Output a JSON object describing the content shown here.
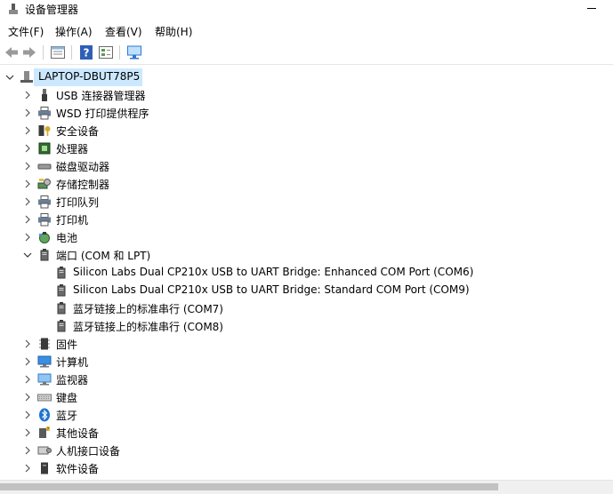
{
  "window": {
    "title": "设备管理器"
  },
  "menu": [
    "文件(F)",
    "操作(A)",
    "查看(V)",
    "帮助(H)"
  ],
  "toolbar": {
    "icons": [
      "back-arrow-icon",
      "forward-arrow-icon",
      "properties-icon",
      "help-icon",
      "show-hidden-icon",
      "monitor-scan-icon"
    ]
  },
  "tree": {
    "root": "LAPTOP-DBUT78P5",
    "categories": [
      {
        "label": "USB 连接器管理器",
        "icon": "usb-icon",
        "expanded": false
      },
      {
        "label": "WSD 打印提供程序",
        "icon": "printer-icon",
        "expanded": false
      },
      {
        "label": "安全设备",
        "icon": "security-key-icon",
        "expanded": false
      },
      {
        "label": "处理器",
        "icon": "processor-icon",
        "expanded": false
      },
      {
        "label": "磁盘驱动器",
        "icon": "disk-drive-icon",
        "expanded": false
      },
      {
        "label": "存储控制器",
        "icon": "storage-controller-icon",
        "expanded": false
      },
      {
        "label": "打印队列",
        "icon": "printer-icon",
        "expanded": false
      },
      {
        "label": "打印机",
        "icon": "printer-icon",
        "expanded": false
      },
      {
        "label": "电池",
        "icon": "battery-icon",
        "expanded": false
      },
      {
        "label": "端口 (COM 和 LPT)",
        "icon": "port-icon",
        "expanded": true,
        "children": [
          "Silicon Labs Dual CP210x USB to UART Bridge: Enhanced COM Port (COM6)",
          "Silicon Labs Dual CP210x USB to UART Bridge: Standard COM Port (COM9)",
          "蓝牙链接上的标准串行 (COM7)",
          "蓝牙链接上的标准串行 (COM8)"
        ]
      },
      {
        "label": "固件",
        "icon": "firmware-icon",
        "expanded": false
      },
      {
        "label": "计算机",
        "icon": "computer-icon",
        "expanded": false
      },
      {
        "label": "监视器",
        "icon": "monitor-icon",
        "expanded": false
      },
      {
        "label": "键盘",
        "icon": "keyboard-icon",
        "expanded": false
      },
      {
        "label": "蓝牙",
        "icon": "bluetooth-icon",
        "expanded": false
      },
      {
        "label": "其他设备",
        "icon": "other-device-icon",
        "expanded": false
      },
      {
        "label": "人机接口设备",
        "icon": "hid-icon",
        "expanded": false
      },
      {
        "label": "软件设备",
        "icon": "software-device-icon",
        "expanded": false
      }
    ]
  },
  "colors": {
    "selection": "#cce8ff",
    "accent": "#1e74d0"
  }
}
